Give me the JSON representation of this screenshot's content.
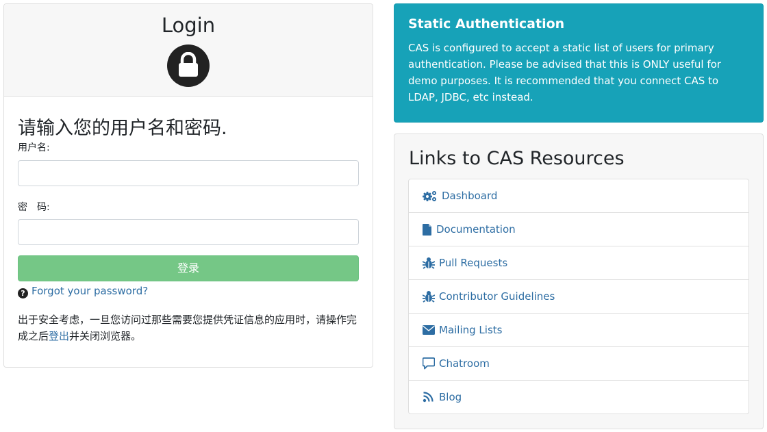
{
  "login": {
    "title": "Login",
    "prompt": "请输入您的用户名和密码.",
    "username_label": "用户名:",
    "username_value": "",
    "password_label": "密　码:",
    "password_value": "",
    "submit_label": "登录",
    "forgot_label": "Forgot your password?",
    "notice_before": "出于安全考虑，一旦您访问过那些需要您提供凭证信息的应用时，请操作完成之后",
    "notice_link": "登出",
    "notice_after": "并关闭浏览器。"
  },
  "static_auth": {
    "title": "Static Authentication",
    "text": "CAS is configured to accept a static list of users for primary authentication. Please be advised that this is ONLY useful for demo purposes. It is recommended that you connect CAS to LDAP, JDBC, etc instead."
  },
  "links": {
    "title": "Links to CAS Resources",
    "items": [
      {
        "label": "Dashboard",
        "icon": "cogs-icon"
      },
      {
        "label": "Documentation",
        "icon": "file-icon"
      },
      {
        "label": "Pull Requests",
        "icon": "bug-icon"
      },
      {
        "label": "Contributor Guidelines",
        "icon": "bug-icon"
      },
      {
        "label": "Mailing Lists",
        "icon": "envelope-icon"
      },
      {
        "label": "Chatroom",
        "icon": "comment-icon"
      },
      {
        "label": "Blog",
        "icon": "rss-icon"
      }
    ]
  },
  "colors": {
    "accent_link": "#2d6da3",
    "info_bg": "#17a2b8",
    "submit_bg": "#75c786"
  }
}
